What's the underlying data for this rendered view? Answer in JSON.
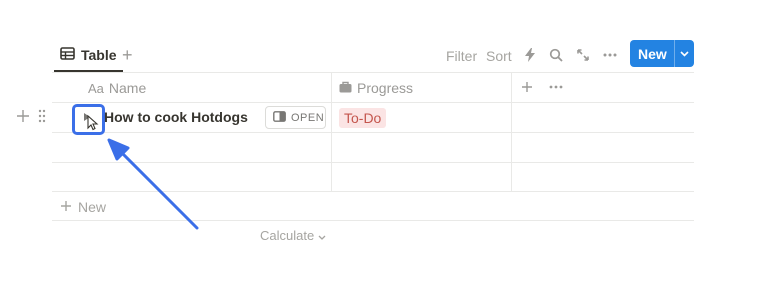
{
  "toolbar": {
    "view_tab_label": "Table",
    "add_view_icon": "plus-icon",
    "filter_label": "Filter",
    "sort_label": "Sort",
    "automation_icon": "lightning-icon",
    "search_icon": "search-icon",
    "expand_icon": "expand-icon",
    "more_icon": "more-horizontal-icon",
    "new_button_label": "New"
  },
  "table": {
    "columns": [
      {
        "prefix": "Aa",
        "label": "Name",
        "icon": "text-property-icon"
      },
      {
        "label": "Progress",
        "icon": "status-briefcase-icon"
      }
    ],
    "rows": [
      {
        "title": "How to cook Hotdogs",
        "open_label": "OPEN",
        "progress": "To-Do"
      }
    ],
    "new_row_label": "New",
    "calculate_label": "Calculate"
  },
  "colors": {
    "accent": "#2383e2",
    "highlight": "#3b6fe8",
    "tag_background": "#fbe4e4",
    "tag_text": "#c4554d"
  }
}
